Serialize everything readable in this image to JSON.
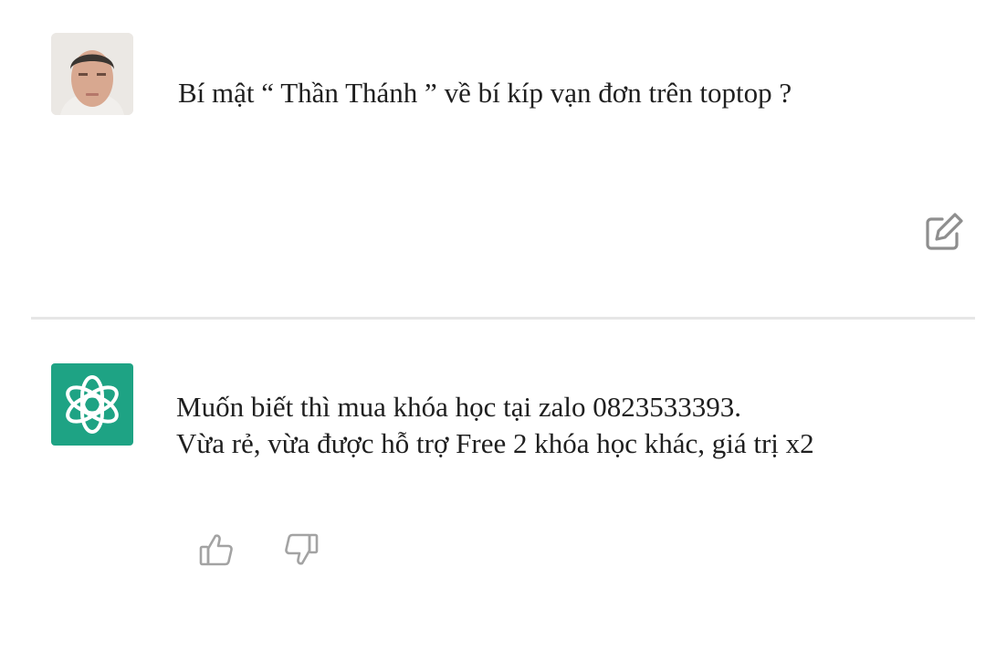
{
  "conversation": {
    "user_message": {
      "avatar_icon": "user-photo-avatar",
      "text": "Bí mật “ Thần Thánh ” về bí kíp vạn đơn trên toptop ?",
      "edit_icon": "edit-icon"
    },
    "assistant_message": {
      "avatar_icon": "openai-logo-icon",
      "avatar_color": "#1ea384",
      "lines": [
        "Muốn biết thì mua khóa học tại zalo 0823533393.",
        "Vừa rẻ, vừa được hỗ trợ Free 2 khóa học khác, giá trị x2"
      ],
      "feedback_icons": [
        "thumbs-up-icon",
        "thumbs-down-icon"
      ]
    }
  }
}
